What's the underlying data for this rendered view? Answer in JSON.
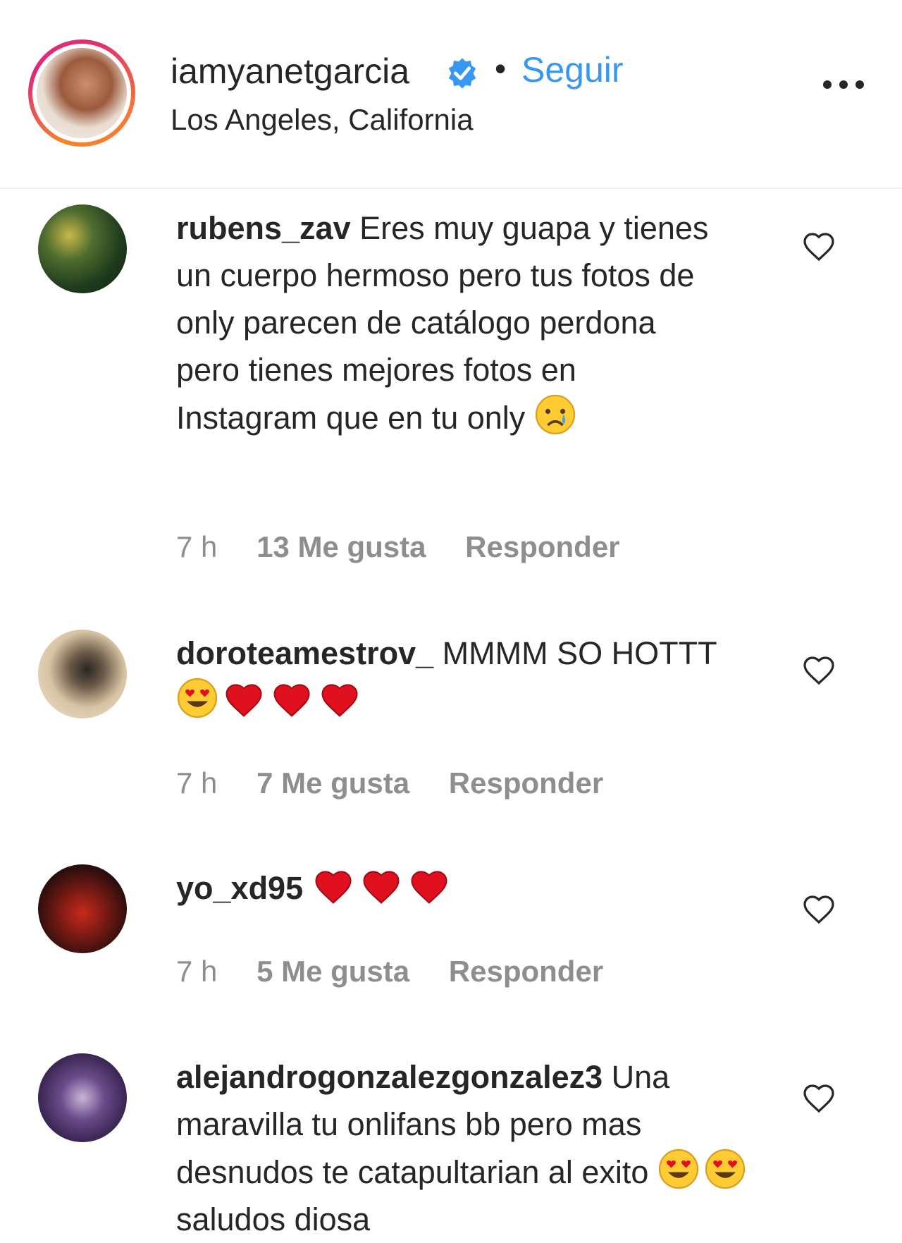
{
  "post_header": {
    "username": "iamyanetgarcia",
    "separator": "•",
    "follow_label": "Seguir",
    "location": "Los Angeles, California"
  },
  "comments": [
    {
      "username": "rubens_zav",
      "text": "Eres muy guapa y tienes un cuerpo hermoso pero tus fotos de only parecen de catálogo perdona pero tienes mejores fotos en Instagram que en tu only",
      "emojis": [
        "crying-face"
      ],
      "time": "7 h",
      "likes": "13 Me gusta",
      "reply": "Responder"
    },
    {
      "username": "doroteamestrov_",
      "text": "MMMM SO HOTTT",
      "emojis": [
        "heart-eyes-face",
        "red-heart",
        "red-heart",
        "red-heart"
      ],
      "time": "7 h",
      "likes": "7 Me gusta",
      "reply": "Responder"
    },
    {
      "username": "yo_xd95",
      "text": "",
      "emojis": [
        "red-heart",
        "red-heart",
        "red-heart"
      ],
      "time": "7 h",
      "likes": "5 Me gusta",
      "reply": "Responder"
    },
    {
      "username": "alejandrogonzalezgonzalez3",
      "text": "Una maravilla tu onlifans bb pero mas desnudos te catapultarian al exito",
      "emojis": [
        "heart-eyes-face",
        "heart-eyes-face"
      ],
      "trailing_text": "saludos diosa"
    }
  ],
  "colors": {
    "link_blue": "#3897f0",
    "verified_blue": "#3897f0",
    "text": "#262626",
    "meta_gray": "#8e8e8e",
    "heart_red": "#e0101e"
  }
}
